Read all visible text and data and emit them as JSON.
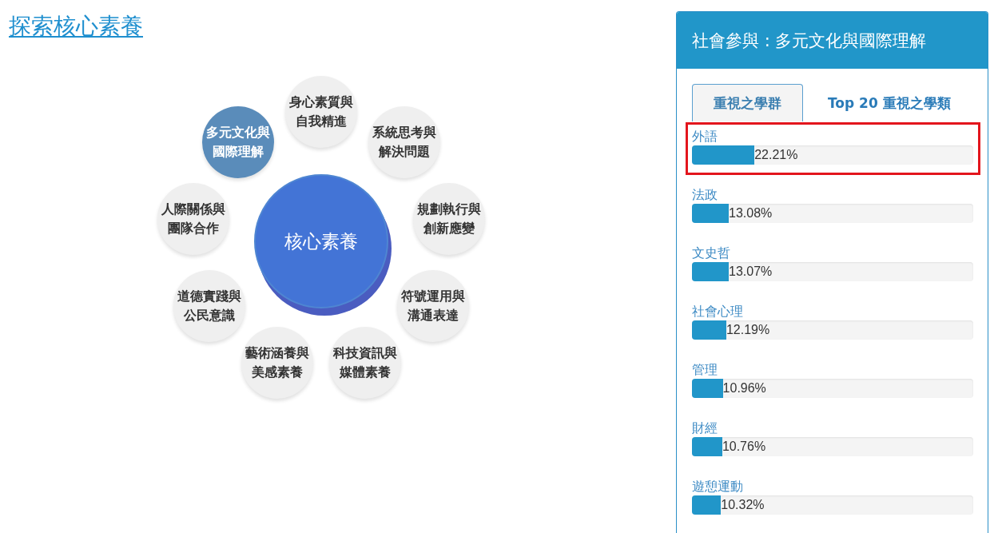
{
  "title": "探索核心素養",
  "diagram": {
    "center": "核心素養",
    "nodes": [
      {
        "label": "身心素質與自我精進",
        "selected": false
      },
      {
        "label": "多元文化與國際理解",
        "selected": true
      },
      {
        "label": "系統思考與解決問題",
        "selected": false
      },
      {
        "label": "人際關係與團隊合作",
        "selected": false
      },
      {
        "label": "規劃執行與創新應變",
        "selected": false
      },
      {
        "label": "道德實踐與公民意識",
        "selected": false
      },
      {
        "label": "符號運用與溝通表達",
        "selected": false
      },
      {
        "label": "藝術涵養與美感素養",
        "selected": false
      },
      {
        "label": "科技資訊與媒體素養",
        "selected": false
      }
    ]
  },
  "panel": {
    "title": "社會參與 : 多元文化與國際理解",
    "tabs": [
      {
        "label": "重視之學群",
        "selected": true
      },
      {
        "label": "Top 20 重視之學類",
        "selected": false
      }
    ],
    "groups": [
      {
        "name": "外語",
        "percent": "22.21%",
        "level": 0.2221,
        "highlighted": true
      },
      {
        "name": "法政",
        "percent": "13.08%",
        "level": 0.1308,
        "highlighted": false
      },
      {
        "name": "文史哲",
        "percent": "13.07%",
        "level": 0.1307,
        "highlighted": false
      },
      {
        "name": "社會心理",
        "percent": "12.19%",
        "level": 0.1219,
        "highlighted": false
      },
      {
        "name": "管理",
        "percent": "10.96%",
        "level": 0.1096,
        "highlighted": false
      },
      {
        "name": "財經",
        "percent": "10.76%",
        "level": 0.1076,
        "highlighted": false
      },
      {
        "name": "遊憩運動",
        "percent": "10.32%",
        "level": 0.1032,
        "highlighted": false
      }
    ]
  }
}
